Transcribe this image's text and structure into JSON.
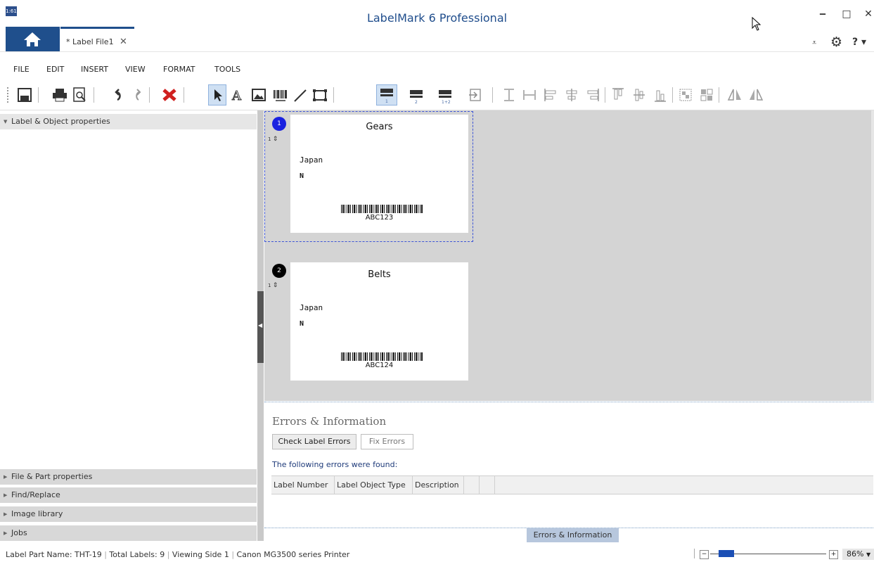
{
  "window": {
    "title": "LabelMark 6 Professional",
    "icon_text": "1:61",
    "minimize": "‒",
    "maximize": "□",
    "close": "✕"
  },
  "tabs": {
    "home_icon": "home-icon",
    "file_tab_label": "* Label File1",
    "file_tab_close": "✕",
    "right_icons": {
      "dropdown": "⩡",
      "settings": "⚙",
      "help": "? ▾"
    }
  },
  "menu": [
    "FILE",
    "EDIT",
    "INSERT",
    "VIEW",
    "FORMAT",
    "TOOLS"
  ],
  "left_panel": {
    "label_props": "Label & Object properties",
    "file_part": "File & Part properties",
    "find_replace": "Find/Replace",
    "image_library": "Image library",
    "jobs": "Jobs"
  },
  "labels": [
    {
      "number": "1",
      "qty": "1",
      "title": "Gears",
      "country": "Japan",
      "code": "N",
      "barcode": "ABC123",
      "badge_color": "#1a22e0"
    },
    {
      "number": "2",
      "qty": "1",
      "title": "Belts",
      "country": "Japan",
      "code": "N",
      "barcode": "ABC124",
      "badge_color": "#000000"
    }
  ],
  "errors": {
    "title": "Errors & Information",
    "check_btn": "Check Label Errors",
    "fix_btn": "Fix Errors",
    "found_text": "The following errors were found:",
    "columns": [
      "Label Number",
      "Label Object Type",
      "Description"
    ],
    "tab_label": "Errors & Information"
  },
  "status": {
    "part_name": "Label Part Name:  THT-19",
    "total": "Total Labels:  9",
    "viewing": "Viewing  Side 1",
    "printer": "Canon MG3500 series Printer",
    "zoom": "86%",
    "zoom_fraction": 0.86
  },
  "colors": {
    "accent": "#1f4f8c",
    "selection": "#3d55d6"
  }
}
